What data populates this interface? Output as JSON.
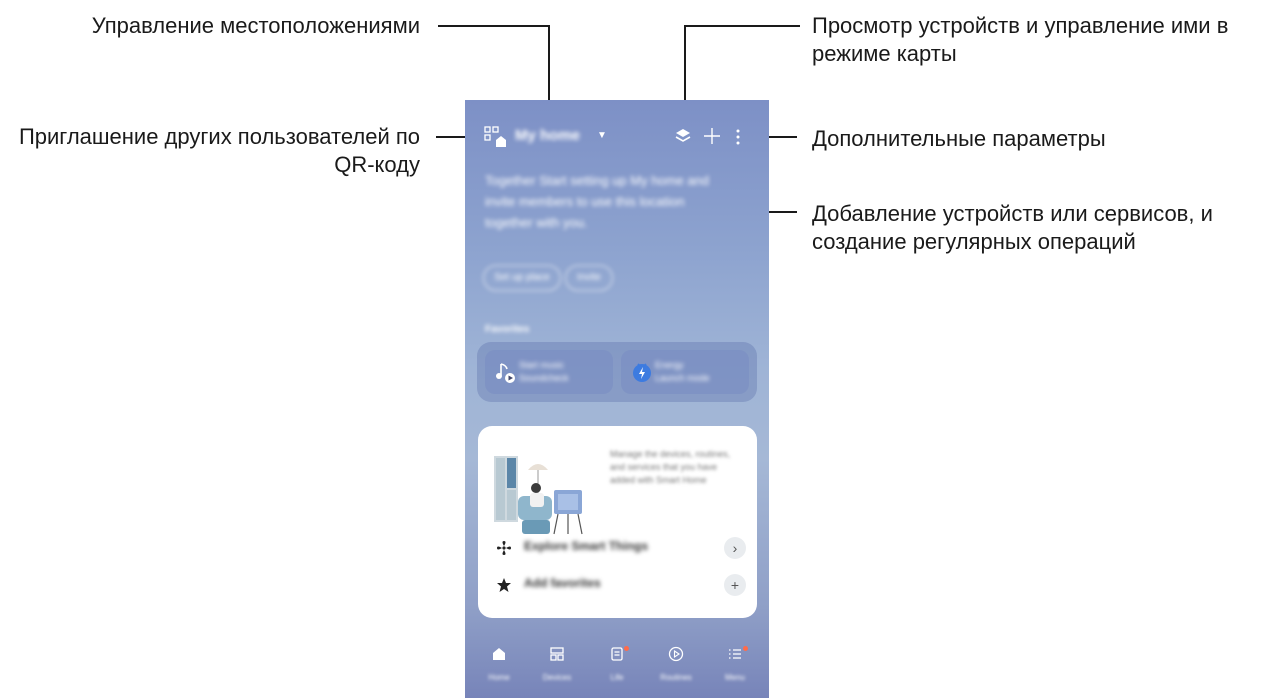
{
  "callouts": {
    "locations": "Управление местоположениями",
    "invite": "Приглашение других пользователей по QR-коду",
    "map_view": "Просмотр устройств и управление ими в режиме карты",
    "more_options": "Дополнительные параметры",
    "add_devices": "Добавление устройств или сервисов, и создание регулярных операций"
  },
  "phone": {
    "location_name": "My home",
    "welcome_text": "Together Start setting up My home and invite members to use this location together with you.",
    "pills": [
      "Set up place",
      "Invite"
    ],
    "favorites_label": "Favorites",
    "favorites": [
      {
        "line1": "Start music",
        "line2": "Soundcheck",
        "icon": "music-note-icon"
      },
      {
        "line1": "Energy",
        "line2": "Launch mode",
        "icon": "energy-bolt-icon"
      }
    ],
    "card_text": "Manage the devices, routines, and services that you have added with Smart Home",
    "card_rows": [
      {
        "label": "Explore Smart Things",
        "icon": "fan-icon",
        "action": "chevron-right-icon"
      },
      {
        "label": "Add favorites",
        "icon": "star-icon",
        "action": "plus-icon"
      }
    ],
    "nav": [
      {
        "label": "Home",
        "icon": "home-icon"
      },
      {
        "label": "Devices",
        "icon": "grid-icon"
      },
      {
        "label": "Life",
        "icon": "document-icon"
      },
      {
        "label": "Routines",
        "icon": "play-icon"
      },
      {
        "label": "Menu",
        "icon": "menu-icon"
      }
    ]
  },
  "colors": {
    "accent": "#ff6b4a",
    "phone_gradient_top": "#7d90c6",
    "phone_gradient_bottom": "#7784b9"
  }
}
